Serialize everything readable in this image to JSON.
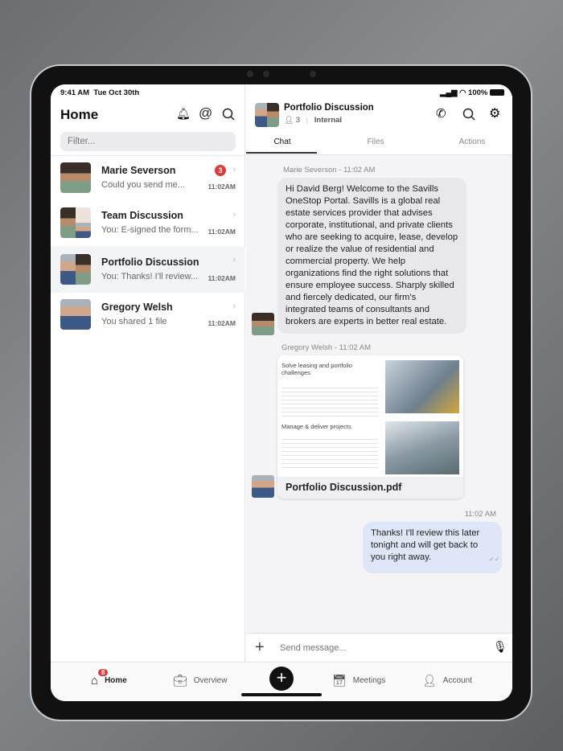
{
  "status": {
    "time": "9:41 AM",
    "date": "Tue Oct 30th",
    "battery": "100%"
  },
  "sidebar": {
    "title": "Home",
    "filter_placeholder": "Filter...",
    "items": [
      {
        "name": "Marie Severson",
        "preview": "Could you send me...",
        "time": "11:02AM",
        "badge": "3"
      },
      {
        "name": "Team Discussion",
        "preview": "You: E-signed the form...",
        "time": "11:02AM"
      },
      {
        "name": "Portfolio Discussion",
        "preview": "You: Thanks! I'll review...",
        "time": "11:02AM"
      },
      {
        "name": "Gregory Welsh",
        "preview": "You shared 1 file",
        "time": "11:02AM"
      }
    ]
  },
  "chat": {
    "title": "Portfolio Discussion",
    "members": "3",
    "tag": "Internal",
    "tabs": [
      "Chat",
      "Files",
      "Actions"
    ],
    "messages": [
      {
        "meta": "Marie Severson - 11:02 AM",
        "text": "Hi David Berg! Welcome to the Savills OneStop Portal. Savills is a global real estate services provider that advises corporate, institutional, and private clients who are seeking to acquire, lease, develop or realize the value of residential and commercial property. We help organizations find the right solutions that ensure employee success. Sharply skilled and fiercely dedicated, our firm's integrated teams of consultants and brokers are experts in better real estate."
      },
      {
        "meta": "Gregory Welsh - 11:02 AM",
        "file": "Portfolio Discussion.pdf",
        "doc_heading1": "Solve leasing and portfolio challenges",
        "doc_heading2": "Manage & deliver projects"
      },
      {
        "meta": "11:02 AM",
        "text": "Thanks! I'll review this later tonight and will get back to you right away."
      }
    ],
    "input_placeholder": "Send message..."
  },
  "nav": {
    "home": "Home",
    "home_badge": "8",
    "overview": "Overview",
    "meetings": "Meetings",
    "account": "Account"
  },
  "colors": {
    "badge": "#e03b3b",
    "own_bubble": "#dde7f7"
  }
}
